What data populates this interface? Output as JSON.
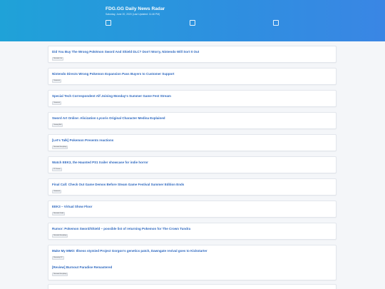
{
  "header": {
    "title": "FDG.GG Daily News Radar",
    "subtitle": "Saturday, June 20, 2020 (Last Updated: 11:46 PM)"
  },
  "articles": [
    {
      "headline": "Did You Buy The Wrong Pokémon Sword And Shield DLC? Don't Worry, Nintendo Will Sort It Out",
      "source": "Nintendo Life"
    },
    {
      "headline": "Nintendo Directs Wrong Pokemon Expansion Pass Buyers to Customer Support",
      "source": "Gamerant"
    },
    {
      "headline": "Special Tech Correspondent Alf Joining Monday's Summer Game Fest Stream",
      "source": "Gamerant"
    },
    {
      "headline": "Sword Art Online: Alicization Lycoris Original Character Medina Explained",
      "source": "Gaming Bolt"
    },
    {
      "headline": "[Let's Talk] Pokemon Presents reactions",
      "source": "Nintendo Everything"
    },
    {
      "headline": "Watch EEK3, the Haunted PS1 trailer showcase for indie horror",
      "source": "PC Gamer"
    },
    {
      "headline": "Final Call: Check Out Game Demos Before Steam Game Festival Summer Edition Ends",
      "source": "Gamerant"
    },
    {
      "headline": "EEK3 – Virtual Show Floor",
      "source": "Nintendo Guide"
    },
    {
      "headline": "Rumor: Pokemon Sword/Shield – possible list of returning Pokemon for The Crown Tundra",
      "source": "Nintendo Everything"
    },
    {
      "headline": "Make My MMO: Illness stymied Project Gorgon's genetics patch, Dawngate revival goes to Kickstarter",
      "source": "Massively OP"
    },
    {
      "headline": "[Review] Burnout Paradise Remastered",
      "source": "Nintendo Everything"
    }
  ]
}
